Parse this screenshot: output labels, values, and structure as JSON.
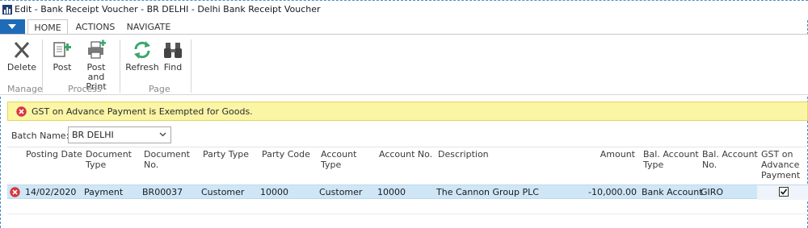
{
  "window": {
    "title": "Edit - Bank Receipt Voucher - BR DELHI - Delhi Bank Receipt Voucher"
  },
  "ribbon": {
    "tabs": [
      {
        "label": "HOME",
        "active": true
      },
      {
        "label": "ACTIONS",
        "active": false
      },
      {
        "label": "NAVIGATE",
        "active": false
      }
    ],
    "buttons": {
      "delete": "Delete",
      "post": "Post",
      "post_and_print_line1": "Post and",
      "post_and_print_line2": "Print",
      "refresh": "Refresh",
      "find": "Find"
    },
    "groups": {
      "manage": "Manage",
      "process": "Process",
      "page": "Page"
    }
  },
  "notification": {
    "message": "GST on Advance Payment is Exempted for Goods.",
    "icon": "error-icon",
    "background": "#fbf5a6"
  },
  "batch": {
    "label": "Batch Name:",
    "value": "BR DELHI"
  },
  "grid": {
    "headers": {
      "posting_date": "Posting Date",
      "document_type_1": "Document",
      "document_type_2": "Type",
      "document_no_1": "Document",
      "document_no_2": "No.",
      "party_type": "Party Type",
      "party_code": "Party Code",
      "account_type_1": "Account",
      "account_type_2": "Type",
      "account_no": "Account No.",
      "description": "Description",
      "amount": "Amount",
      "bal_account_type_1": "Bal. Account",
      "bal_account_type_2": "Type",
      "bal_account_no_1": "Bal. Account",
      "bal_account_no_2": "No.",
      "gst_1": "GST on",
      "gst_2": "Advance",
      "gst_3": "Payment"
    },
    "rows": [
      {
        "has_error": true,
        "posting_date": "14/02/2020",
        "document_type": "Payment",
        "document_no": "BR00037",
        "party_type": "Customer",
        "party_code": "10000",
        "account_type": "Customer",
        "account_no": "10000",
        "description": "The Cannon Group PLC",
        "amount": "-10,000.00",
        "bal_account_type": "Bank Account",
        "bal_account_no": "GIRO",
        "gst_on_advance_payment": true
      }
    ]
  },
  "colors": {
    "accent": "#1e6bb8",
    "selected_row": "#cfe6f7",
    "error": "#d9363e"
  }
}
